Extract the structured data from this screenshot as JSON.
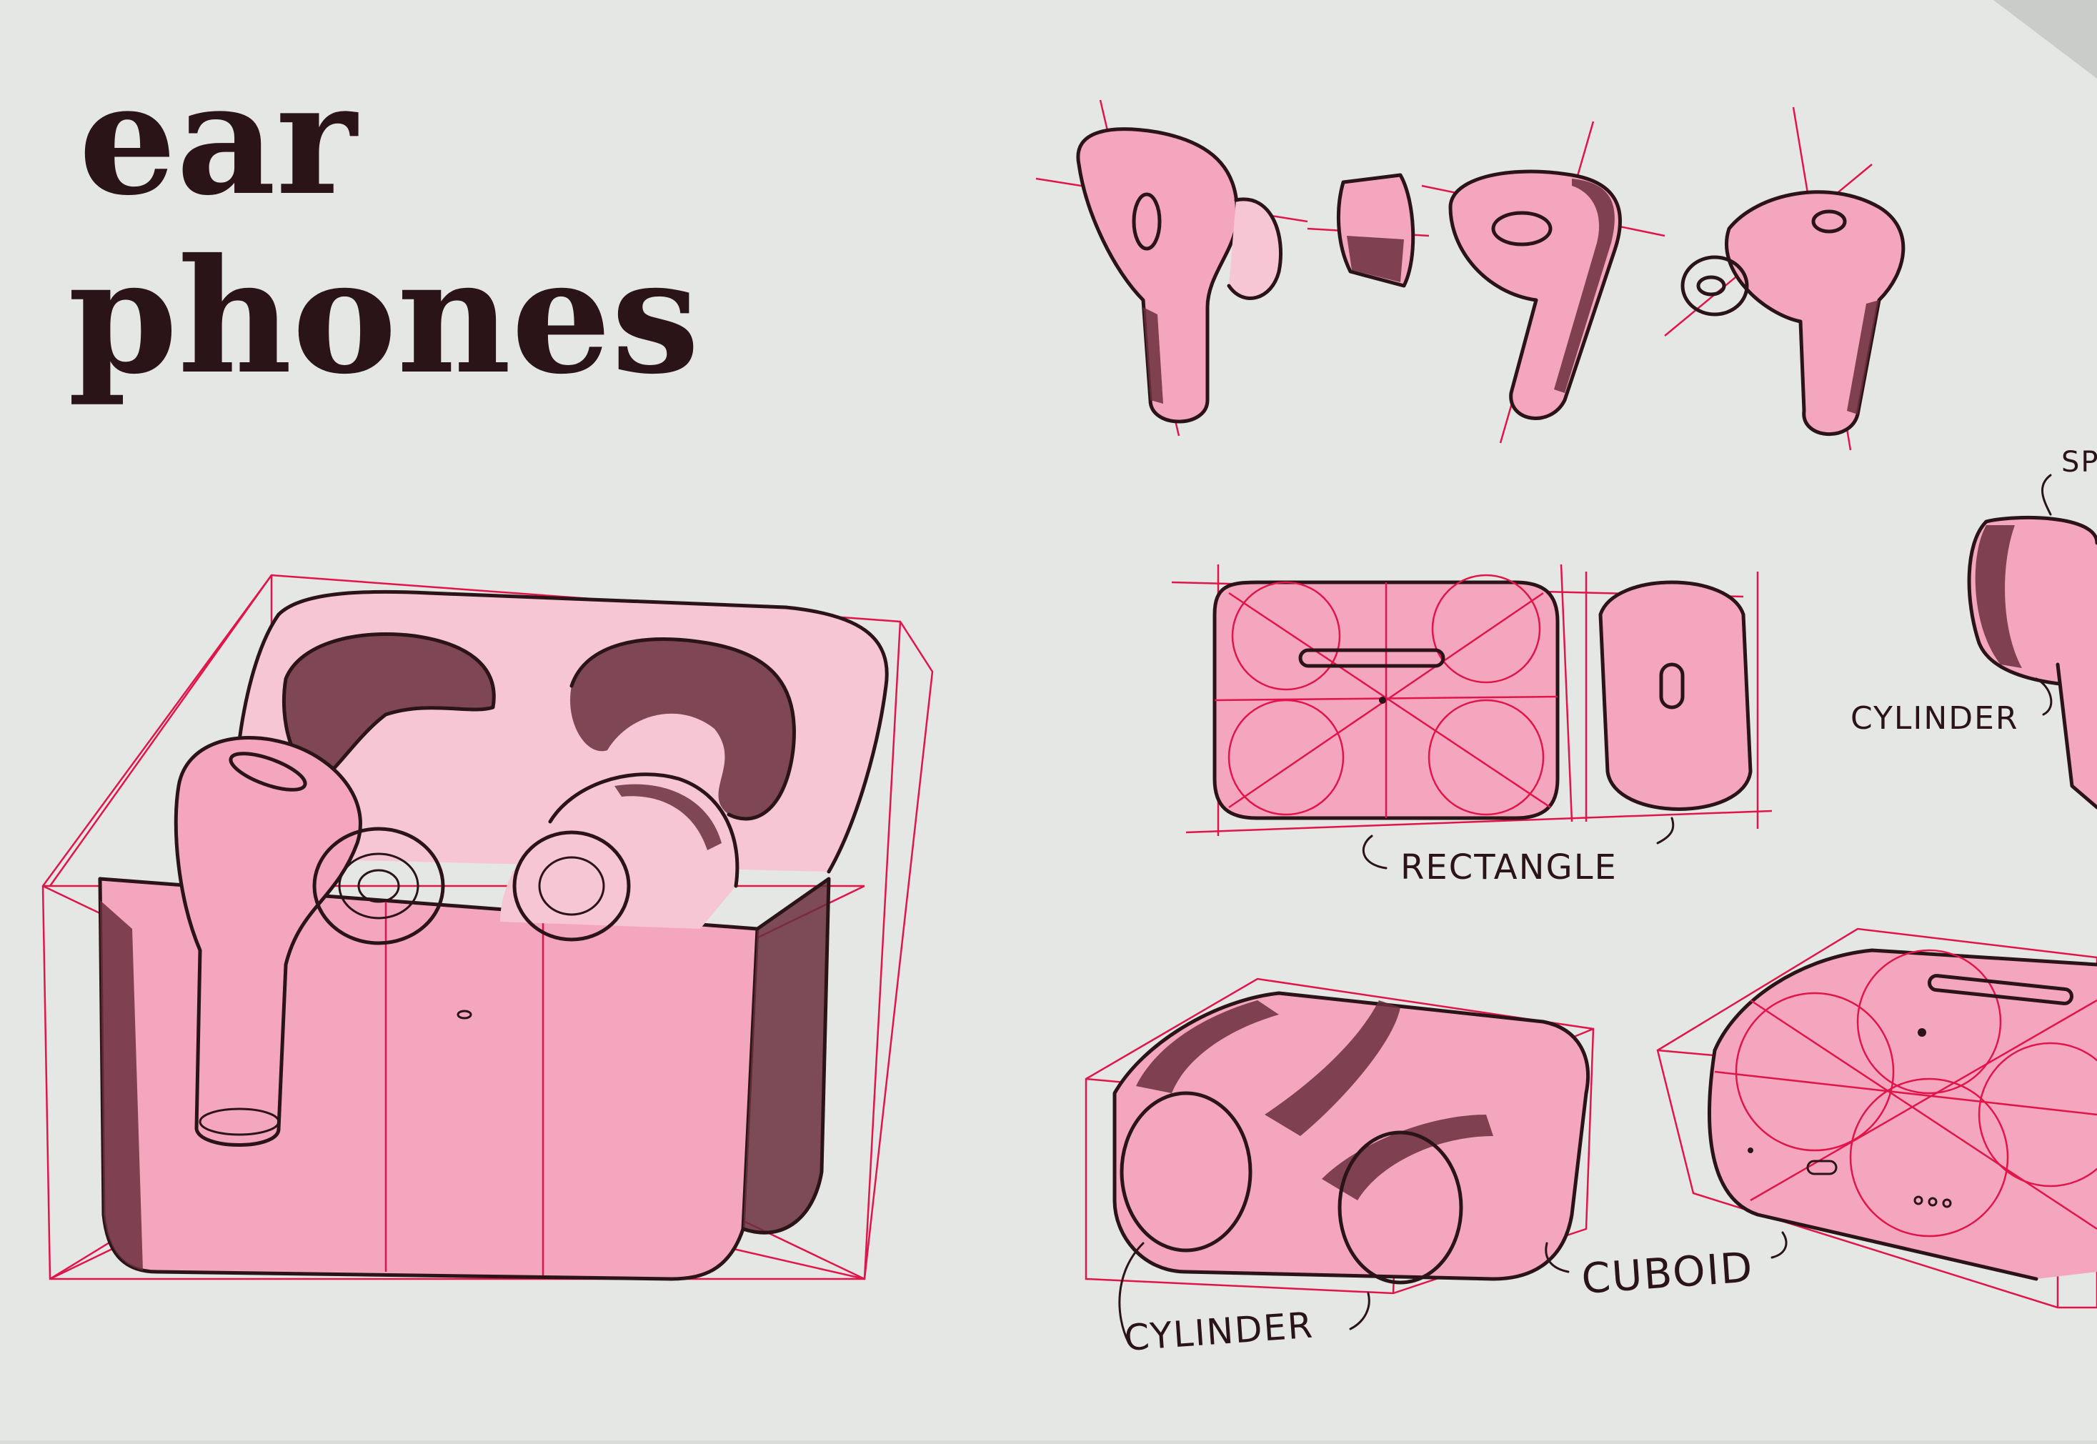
{
  "title": {
    "line1": "ear",
    "line2": "phones"
  },
  "labels": {
    "cylinder_top_right": "CYLINDER",
    "rectangle": "RECTANGLE",
    "sp_partial": "SP",
    "cylinder_bottom": "CYLINDER",
    "cuboid": "CUBOID"
  },
  "colors": {
    "paper": "#e4e7e3",
    "ink": "#2a1418",
    "marker_pink": "#f3a6bd",
    "construction_red": "#e0154a"
  }
}
